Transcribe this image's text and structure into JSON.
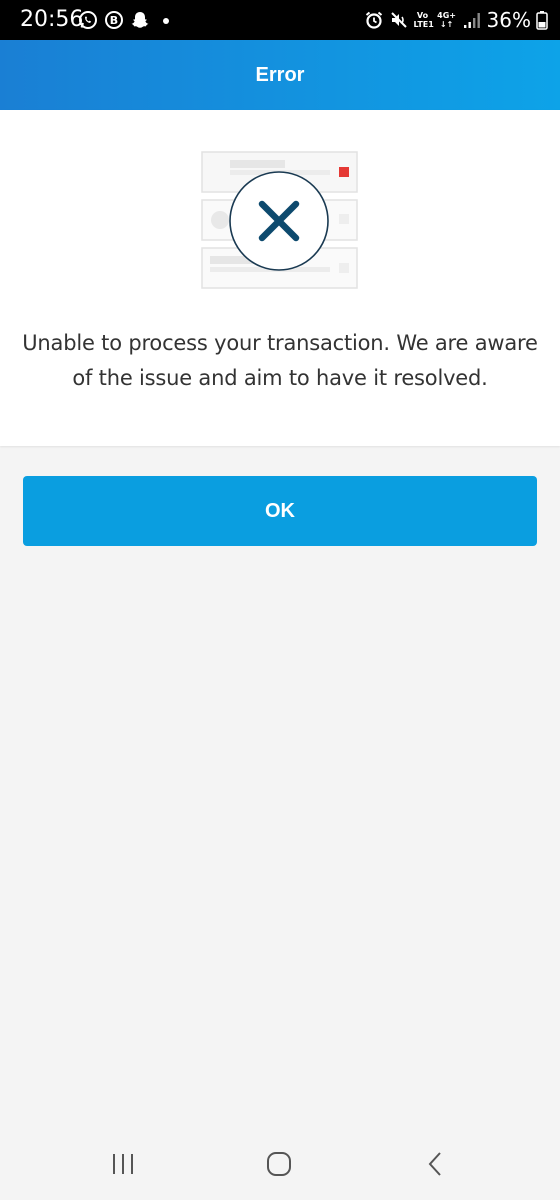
{
  "status_bar": {
    "time": "20:56",
    "battery_percent": "36%",
    "network_top": "Vo",
    "network_bottom": "LTE1",
    "network_type": "4G+",
    "left_icons": [
      "whatsapp-icon",
      "b-badge-icon",
      "snapchat-icon",
      "notification-dot-icon"
    ],
    "right_icons": [
      "alarm-icon",
      "mute-icon",
      "signal-icon",
      "battery-icon"
    ],
    "b_letter": "B"
  },
  "header": {
    "title": "Error",
    "gradient_start": "#1a7fd4",
    "gradient_end": "#0da3e8"
  },
  "error": {
    "illustration_icon": "error-x-icon",
    "message": "Unable to process your transaction. We are aware of the issue and aim to have it resolved."
  },
  "actions": {
    "ok_label": "OK",
    "ok_color": "#0a9ee0"
  },
  "navigation": {
    "items": [
      "recent-apps-icon",
      "home-icon",
      "back-icon"
    ]
  }
}
